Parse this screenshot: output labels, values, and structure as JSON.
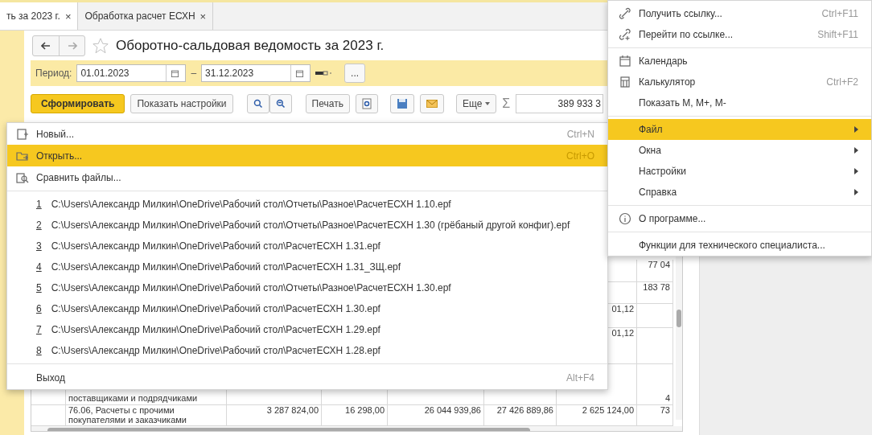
{
  "tabs": [
    {
      "label": "ть за 2023 г.",
      "close": "×",
      "selected": true
    },
    {
      "label": "Обработка расчет ЕСХН",
      "close": "×",
      "selected": false
    }
  ],
  "form": {
    "title": "Оборотно-сальдовая ведомость за 2023 г.",
    "favorite": false,
    "period_label": "Период:",
    "date_from": "01.01.2023",
    "dash": "–",
    "date_to": "31.12.2023",
    "more": "...",
    "toolbar": {
      "generate": "Сформировать",
      "show_settings": "Показать настройки",
      "print": "Печать",
      "more": "Еще",
      "sum_sign": "Σ",
      "sum": "389 933 3"
    }
  },
  "table": {
    "rows": [
      {
        "col_6": "77 04"
      },
      {
        "col_6": "183 78"
      },
      {
        "col_5": "01,12"
      },
      {
        "col_5": "01,12"
      },
      {
        "name": "поставщиками и подрядчиками",
        "col_6": "4"
      },
      {
        "name": "76.06, Расчеты с прочими покупателями и заказчиками",
        "col_1": "3 287 824,00",
        "col_2": "16 298,00",
        "col_3": "26 044 939,86",
        "col_4": "27 426 889,86",
        "col_5": "2 625 124,00",
        "col_6": "73"
      }
    ]
  },
  "file_menu": {
    "commands": [
      {
        "kind": "new",
        "label": "Новый...",
        "shortcut": "Ctrl+N",
        "selected": false
      },
      {
        "kind": "open",
        "label": "Открыть...",
        "shortcut": "Ctrl+O",
        "selected": true
      },
      {
        "kind": "compare",
        "label": "Сравнить файлы...",
        "selected": false
      }
    ],
    "recent": [
      {
        "number": "1",
        "path": "C:\\Users\\Александр Милкин\\OneDrive\\Рабочий стол\\Отчеты\\Разное\\РасчетЕСХН 1.10.epf"
      },
      {
        "number": "2",
        "path": "C:\\Users\\Александр Милкин\\OneDrive\\Рабочий стол\\Отчеты\\Разное\\РасчетЕСХН 1.30 (грёбаный другой конфиг).epf"
      },
      {
        "number": "3",
        "path": "C:\\Users\\Александр Милкин\\OneDrive\\Рабочий стол\\РасчетЕСХН 1.31.epf"
      },
      {
        "number": "4",
        "path": "C:\\Users\\Александр Милкин\\OneDrive\\Рабочий стол\\РасчетЕСХН 1.31_ЗЩ.epf"
      },
      {
        "number": "5",
        "path": "C:\\Users\\Александр Милкин\\OneDrive\\Рабочий стол\\Отчеты\\Разное\\РасчетЕСХН 1.30.epf"
      },
      {
        "number": "6",
        "path": "C:\\Users\\Александр Милкин\\OneDrive\\Рабочий стол\\РасчетЕСХН 1.30.epf"
      },
      {
        "number": "7",
        "path": "C:\\Users\\Александр Милкин\\OneDrive\\Рабочий стол\\РасчетЕСХН 1.29.epf"
      },
      {
        "number": "8",
        "path": "C:\\Users\\Александр Милкин\\OneDrive\\Рабочий стол\\РасчетЕСХН 1.28.epf"
      }
    ],
    "exit": {
      "label": "Выход",
      "shortcut": "Alt+F4"
    }
  },
  "main_menu": {
    "groups": [
      {
        "items": [
          {
            "kind": "get-link",
            "label": "Получить ссылку...",
            "shortcut": "Ctrl+F11",
            "selected": false
          },
          {
            "kind": "go-link",
            "label": "Перейти по ссылке...",
            "shortcut": "Shift+F11",
            "selected": false
          }
        ]
      },
      {
        "items": [
          {
            "kind": "calendar",
            "label": "Календарь",
            "selected": false
          },
          {
            "kind": "calculator",
            "label": "Калькулятор",
            "shortcut": "Ctrl+F2",
            "selected": false
          },
          {
            "kind": "plain",
            "label": "Показать M, M+, M-",
            "selected": false
          }
        ]
      },
      {
        "items": [
          {
            "kind": "submenu",
            "label": "Файл",
            "selected": true
          },
          {
            "kind": "submenu",
            "label": "Окна",
            "selected": false
          },
          {
            "kind": "submenu",
            "label": "Настройки",
            "selected": false
          },
          {
            "kind": "submenu",
            "label": "Справка",
            "selected": false
          }
        ]
      },
      {
        "items": [
          {
            "kind": "info",
            "label": "О программе...",
            "selected": false
          }
        ]
      },
      {
        "items": [
          {
            "kind": "plain",
            "label": "Функции для технического специалиста...",
            "selected": false
          }
        ]
      }
    ]
  }
}
